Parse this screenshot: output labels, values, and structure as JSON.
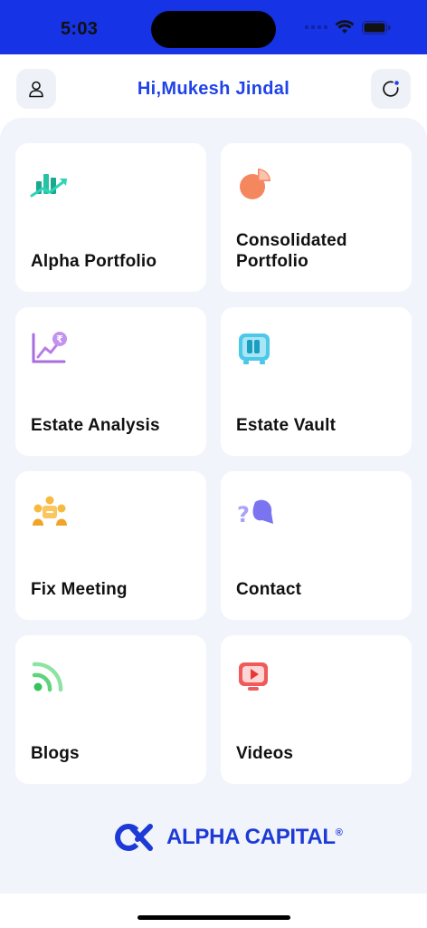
{
  "status": {
    "time": "5:03"
  },
  "header": {
    "greeting": "Hi,Mukesh Jindal",
    "profile_icon": "person-icon",
    "refresh_icon": "refresh-icon"
  },
  "menu": {
    "items": [
      {
        "label": "Alpha Portfolio",
        "icon": "growth-chart-icon"
      },
      {
        "label": "Consolidated\nPortfolio",
        "icon": "pie-chart-icon"
      },
      {
        "label": "Estate Analysis",
        "icon": "rupee-trend-icon"
      },
      {
        "label": "Estate Vault",
        "icon": "vault-icon"
      },
      {
        "label": "Fix Meeting",
        "icon": "meeting-icon"
      },
      {
        "label": "Contact",
        "icon": "question-chat-icon"
      },
      {
        "label": "Blogs",
        "icon": "rss-icon"
      },
      {
        "label": "Videos",
        "icon": "video-play-icon"
      }
    ]
  },
  "brand": {
    "name": "ALPHA CAPITAL",
    "registered": "®"
  },
  "colors": {
    "status_bar": "#1733e6",
    "accent": "#2043e8",
    "background": "#f1f4fb"
  }
}
